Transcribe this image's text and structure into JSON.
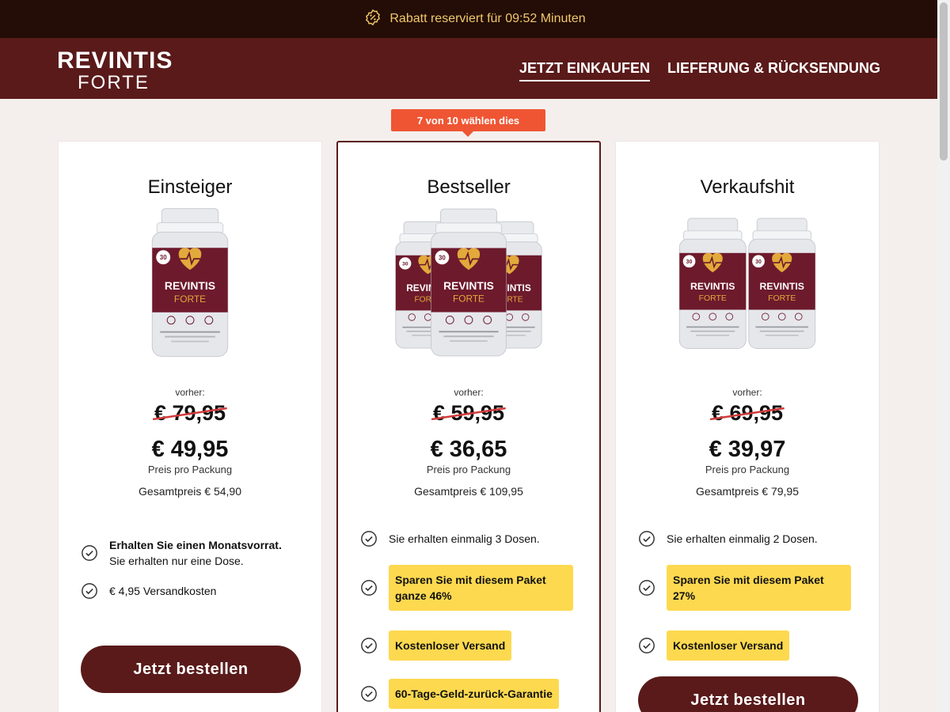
{
  "topbar": {
    "text": "Rabatt reserviert für 09:52 Minuten",
    "icon": "discount-badge-icon"
  },
  "brand": {
    "line1": "REVINTIS",
    "line2": "FORTE"
  },
  "nav": [
    {
      "label": "JETZT EINKAUFEN",
      "active": true
    },
    {
      "label": "LIEFERUNG & RÜCKSENDUNG",
      "active": false
    }
  ],
  "product_label": {
    "line1": "REVINTIS",
    "line2": "FORTE",
    "count": "30"
  },
  "badge": "7 von 10 wählen dies",
  "colors": {
    "brand": "#5a1a1a",
    "topbar": "#230d06",
    "accent": "#ef5533",
    "highlight": "#fdd94f",
    "timer": "#f2c86a"
  },
  "cards": [
    {
      "title": "Einsteiger",
      "bottles": 1,
      "was_label": "vorher:",
      "was": "€ 79,95",
      "now": "€ 49,95",
      "unit": "Preis pro Packung",
      "total": "Gesamtpreis € 54,90",
      "features": [
        {
          "bold": "Erhalten Sie einen Monatsvorrat.",
          "text": "Sie erhalten nur eine Dose."
        },
        {
          "text": "€ 4,95 Versandkosten"
        }
      ],
      "button": "Jetzt bestellen"
    },
    {
      "title": "Bestseller",
      "bottles": 3,
      "was_label": "vorher:",
      "was": "€ 59,95",
      "now": "€ 36,65",
      "unit": "Preis pro Packung",
      "total": "Gesamtpreis € 109,95",
      "features": [
        {
          "text": "Sie erhalten einmalig 3 Dosen."
        },
        {
          "highlight_line1": "Sparen Sie mit diesem Paket",
          "highlight_line2": "ganze 46%"
        },
        {
          "highlight": "Kostenloser Versand"
        },
        {
          "highlight": "60-Tage-Geld-zurück-Garantie"
        }
      ]
    },
    {
      "title": "Verkaufshit",
      "bottles": 2,
      "was_label": "vorher:",
      "was": "€ 69,95",
      "now": "€ 39,97",
      "unit": "Preis pro Packung",
      "total": "Gesamtpreis € 79,95",
      "features": [
        {
          "text": "Sie erhalten einmalig 2 Dosen."
        },
        {
          "highlight_line1": "Sparen Sie mit diesem Paket",
          "highlight_line2": "27%"
        },
        {
          "highlight": "Kostenloser Versand"
        }
      ],
      "button": "Jetzt bestellen"
    }
  ]
}
